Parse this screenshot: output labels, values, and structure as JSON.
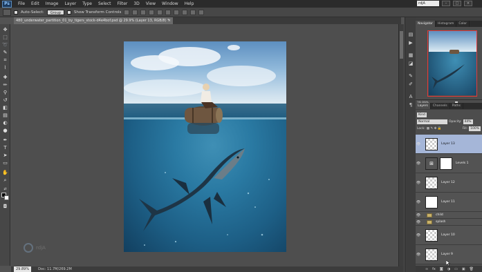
{
  "app": {
    "logo": "Ps",
    "menu": [
      "File",
      "Edit",
      "Image",
      "Layer",
      "Type",
      "Select",
      "Filter",
      "3D",
      "View",
      "Window",
      "Help"
    ],
    "workspace": "rdjA"
  },
  "options_bar": {
    "auto_select_label": "Auto-Select:",
    "auto_select_value": "Group",
    "show_transform_label": "Show Transform Controls"
  },
  "document": {
    "tab_title": "480_underwater_partition_01_by_tigers_stock-d4e4bof.psd @ 29.9% (Layer 13, RGB/8) *",
    "close": "×"
  },
  "watermark": {
    "text": "rdjA"
  },
  "status_bar": {
    "zoom": "29.89%",
    "doc_info": "Doc: 11.7M/269.2M"
  },
  "panels": {
    "navigator": {
      "tabs": [
        "Navigator",
        "Histogram",
        "Color"
      ],
      "active_tab": "Navigator",
      "zoom": "29.89%"
    },
    "layers": {
      "tabs": [
        "Layers",
        "Channels",
        "Paths"
      ],
      "active_tab": "Layers",
      "filter_kind": "Kind",
      "blend_mode": "Normal",
      "opacity_label": "Opacity:",
      "opacity_value": "44%",
      "lock_label": "Lock:",
      "fill_label": "Fill:",
      "fill_value": "100%",
      "items": [
        {
          "name": "Layer 13",
          "selected": true
        },
        {
          "name": "Levels 1",
          "selected": false
        },
        {
          "name": "Layer 12",
          "selected": false
        },
        {
          "name": "Layer 11",
          "selected": false
        },
        {
          "name": "child",
          "group": true
        },
        {
          "name": "splash",
          "group": true
        },
        {
          "name": "Layer 10",
          "selected": false
        },
        {
          "name": "Layer 9",
          "selected": false
        }
      ]
    }
  },
  "colors": {
    "accent_selected_layer": "#a5b6d8",
    "navigator_proxy": "#e43a3a",
    "ui_background": "#535353"
  }
}
